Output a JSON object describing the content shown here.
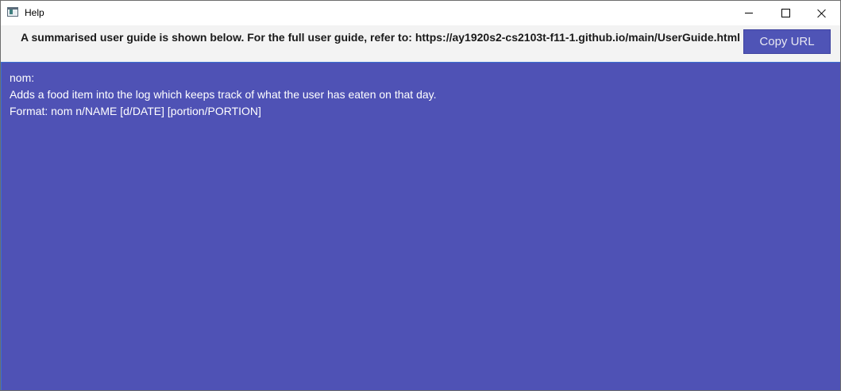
{
  "window": {
    "title": "Help"
  },
  "header": {
    "message": "A summarised user guide is shown below. For the full user guide, refer to: https://ay1920s2-cs2103t-f11-1.github.io/main/UserGuide.html",
    "copy_button_label": "Copy URL"
  },
  "content": {
    "lines": [
      "nom:",
      "Adds a food item into the log which keeps track of what the user has eaten on that day.",
      "Format: nom n/NAME [d/DATE] [portion/PORTION]"
    ]
  },
  "colors": {
    "content_background": "#4f52b5",
    "button_background": "#4f54b6",
    "header_background": "#f3f3f3"
  },
  "icons": {
    "app": "window-app-icon",
    "minimize": "minimize-icon",
    "maximize": "maximize-icon",
    "close": "close-icon"
  }
}
